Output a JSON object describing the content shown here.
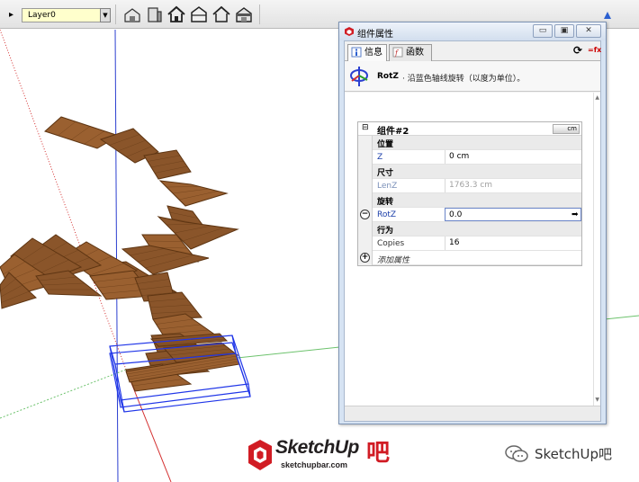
{
  "toolbar": {
    "layer_name": "Layer0",
    "house_icons": [
      "warehouse-icon",
      "building-icon",
      "house-icon",
      "house-icon",
      "house-outline-icon",
      "barn-icon"
    ]
  },
  "dialog": {
    "title": "组件属性",
    "tabs": [
      {
        "label": "信息",
        "active": true
      },
      {
        "label": "函数",
        "active": false
      }
    ],
    "selected_attribute": {
      "name": "RotZ",
      "description": "沿蓝色轴线旋转（以度为单位）。"
    },
    "component_name": "组件#2",
    "unit_button": "cm",
    "rows": [
      {
        "kind": "category",
        "label": "位置"
      },
      {
        "kind": "attr",
        "name": "Z",
        "value": "0 cm",
        "style": "normal"
      },
      {
        "kind": "category",
        "label": "尺寸"
      },
      {
        "kind": "attr",
        "name": "LenZ",
        "value": "1763.3 cm",
        "style": "gray"
      },
      {
        "kind": "category",
        "label": "旋转"
      },
      {
        "kind": "attr",
        "name": "RotZ",
        "value": "0.0",
        "style": "selected"
      },
      {
        "kind": "category",
        "label": "行为"
      },
      {
        "kind": "attr",
        "name": "Copies",
        "value": "16",
        "style": "plain"
      },
      {
        "kind": "add",
        "name": "添加属性"
      }
    ]
  },
  "watermark": {
    "brand": "SketchUp",
    "brand_suffix": "吧",
    "url": "sketchupbar.com",
    "social": "SketchUp吧"
  },
  "colors": {
    "wood": "#8a552a",
    "wood_dark": "#5e3512",
    "blue_axis": "#2b3fd0",
    "red_axis": "#d43030",
    "green_axis": "#5fbf5f",
    "brand_red": "#d11c24"
  }
}
